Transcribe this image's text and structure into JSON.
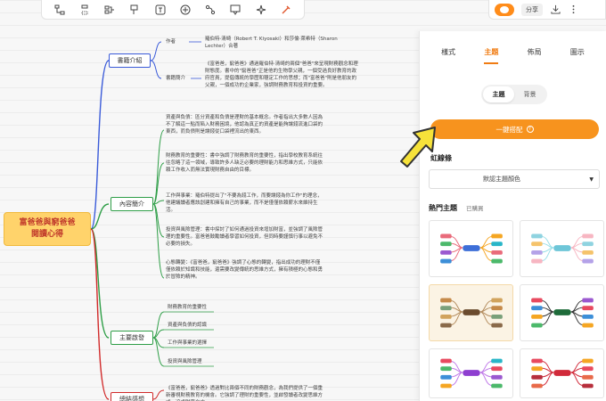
{
  "toolbar": {
    "tools": [
      "subtopic-icon",
      "sibling-icon",
      "summary-icon",
      "boundary-icon",
      "text-icon",
      "add-icon",
      "relation-icon",
      "comment-icon",
      "sparkle-icon",
      "format-painter-icon"
    ]
  },
  "topright": {
    "share_label": "分享"
  },
  "mindmap": {
    "root_line1": "富爸爸與窮爸爸",
    "root_line2": "閱讀心得",
    "branches": {
      "book_intro": "書籍介紹",
      "content_intro": "內容簡介",
      "main_points": "主要啟發",
      "conclusion": "總結感想"
    },
    "author_label": "作者",
    "author_text": "羅伯特·清崎（Robert T. Kiyosaki）和莎倫·萊希特（Sharon Lechter）合著",
    "book_intro_label": "書籍簡介",
    "book_intro_text": "《富爸爸，窮爸爸》通過羅伯特·清崎的兩個\"爸爸\"來呈現財務觀念和理財態度。書中的\"窮爸爸\"正是他的生物學父親，一個受過良好教育的政府官員，提倡傳統的學歷和穩定工作的思想；而\"富爸爸\"則是他朋友的父親，一個成功的企業家，強調財務教育和投資的重要。",
    "content_1": "資產與負債：區分資產和負債是理財的基本概念。作者指出大多數人因為不了解這一點而陷入財務困境，他認為真正的資產是能夠讓錢流進口袋的東西，而負債則是讓錢從口袋裡流出的東西。",
    "content_2": "財務教育的重要性：書中強調了財務教育的重要性，指出學校教育系統往往忽略了這一領域，導致許多人缺乏必要的理財能力和思維方式，只能依賴工作收入而無法實現財務自由的目標。",
    "content_3": "工作與事業：羅伯特提出了\"不要為錢工作，而要讓錢為你工作\"的理念，他建議讀者應該創建和擁有自己的事業，而不是僅僅依賴薪水來維持生活。",
    "content_4": "投資與風險管理：書中探討了如何通過投資來增加財富，並強調了風險管理的重要性。富爸爸鼓勵讀者學習如何投資，但同時要謹慎行事以避免不必要的損失。",
    "content_5": "心態轉變：《富爸爸，窮爸爸》強調了心態的轉變，指出成功的理財不僅僅依賴於知識和技能，還需要改變傳統的思維方式，擁有積極的心態和勇於冒險的精神。",
    "main_1": "財務教育的重要性",
    "main_2": "資產與負債的認識",
    "main_3": "工作與事業的選擇",
    "main_4": "投資與風險管理",
    "conclusion_text": "《富爸爸，窮爸爸》透過對比兩個不同的財務觀念，為我們提供了一個重新審視財務教育的機會。它強調了理財的重要性，並啟發讀者改變思維方式，追求財務自由。"
  },
  "panel": {
    "tabs": [
      "樣式",
      "主題",
      "佈局",
      "圖示"
    ],
    "active_tab": "主題",
    "segments": [
      "主題",
      "背景"
    ],
    "onekey_label": "一鍵搭配",
    "rainbow_label": "虹線條",
    "select_value": "默認主題顏色",
    "hot_title": "熱門主題",
    "hot_bought": "已購買"
  },
  "colors": {
    "accent": "#f7931e",
    "root_fill": "#ffd36b",
    "branch_book": "#3a5bd9",
    "branch_content": "#2e9e47",
    "branch_main": "#2e9e47",
    "branch_conclusion": "#d12a2a"
  }
}
